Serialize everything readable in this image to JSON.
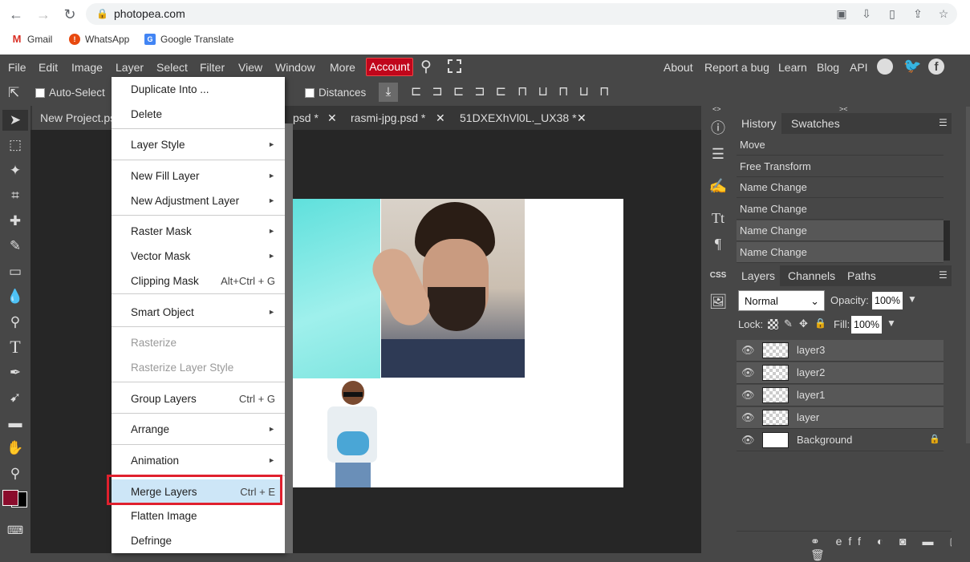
{
  "browser": {
    "url": "photopea.com",
    "bookmarks": [
      "Gmail",
      "WhatsApp",
      "Google Translate"
    ]
  },
  "menubar": {
    "items": [
      "File",
      "Edit",
      "Image",
      "Layer",
      "Select",
      "Filter",
      "View",
      "Window",
      "More"
    ],
    "account": "Account",
    "right_items": [
      "About",
      "Report a bug",
      "Learn",
      "Blog",
      "API"
    ]
  },
  "options": {
    "auto_select": "Auto-Select",
    "distances": "Distances"
  },
  "tabs": [
    {
      "label": "New Project.psd"
    },
    {
      "label": "psd *"
    },
    {
      "label": "rasmi-jpg.psd *"
    },
    {
      "label": "51DXEXhVl0L._UX38 *"
    }
  ],
  "layer_menu": {
    "items": [
      {
        "label": "Duplicate Into ...",
        "shortcut": "",
        "submenu": false,
        "disabled": false
      },
      {
        "label": "Delete",
        "shortcut": "",
        "submenu": false,
        "disabled": false
      },
      {
        "label": "Layer Style",
        "shortcut": "",
        "submenu": true,
        "disabled": false
      },
      {
        "label": "New Fill Layer",
        "shortcut": "",
        "submenu": true,
        "disabled": false
      },
      {
        "label": "New Adjustment Layer",
        "shortcut": "",
        "submenu": true,
        "disabled": false
      },
      {
        "label": "Raster Mask",
        "shortcut": "",
        "submenu": true,
        "disabled": false
      },
      {
        "label": "Vector Mask",
        "shortcut": "",
        "submenu": true,
        "disabled": false
      },
      {
        "label": "Clipping Mask",
        "shortcut": "Alt+Ctrl + G",
        "submenu": false,
        "disabled": false
      },
      {
        "label": "Smart Object",
        "shortcut": "",
        "submenu": true,
        "disabled": false
      },
      {
        "label": "Rasterize",
        "shortcut": "",
        "submenu": false,
        "disabled": true
      },
      {
        "label": "Rasterize Layer Style",
        "shortcut": "",
        "submenu": false,
        "disabled": true
      },
      {
        "label": "Group Layers",
        "shortcut": "Ctrl + G",
        "submenu": false,
        "disabled": false
      },
      {
        "label": "Arrange",
        "shortcut": "",
        "submenu": true,
        "disabled": false
      },
      {
        "label": "Animation",
        "shortcut": "",
        "submenu": true,
        "disabled": false
      },
      {
        "label": "Merge Layers",
        "shortcut": "Ctrl + E",
        "submenu": false,
        "disabled": false,
        "highlighted": true
      },
      {
        "label": "Flatten Image",
        "shortcut": "",
        "submenu": false,
        "disabled": false
      },
      {
        "label": "Defringe",
        "shortcut": "",
        "submenu": false,
        "disabled": false
      }
    ]
  },
  "history_panel": {
    "tabs": [
      "History",
      "Swatches"
    ],
    "entries": [
      "Move",
      "Free Transform",
      "Name Change",
      "Name Change",
      "Name Change",
      "Name Change"
    ]
  },
  "layers_panel": {
    "tabs": [
      "Layers",
      "Channels",
      "Paths"
    ],
    "blend_mode": "Normal",
    "opacity_label": "Opacity:",
    "opacity": "100%",
    "lock_label": "Lock:",
    "fill_label": "Fill:",
    "fill": "100%",
    "layers": [
      {
        "name": "layer3",
        "selected": true
      },
      {
        "name": "layer2",
        "selected": true
      },
      {
        "name": "layer1",
        "selected": true
      },
      {
        "name": "layer",
        "selected": true
      },
      {
        "name": "Background",
        "selected": false,
        "locked": true
      }
    ]
  },
  "side_icons": [
    "info-icon",
    "adjust-icon",
    "brush-settings-icon",
    "text-icon",
    "paragraph-icon",
    "css-icon",
    "image-icon"
  ],
  "colors": {
    "foreground": "#8a0c2c",
    "background": "#000000",
    "accent": "#c0061b",
    "highlight": "#cde6f7",
    "annotation": "#e0202e"
  }
}
